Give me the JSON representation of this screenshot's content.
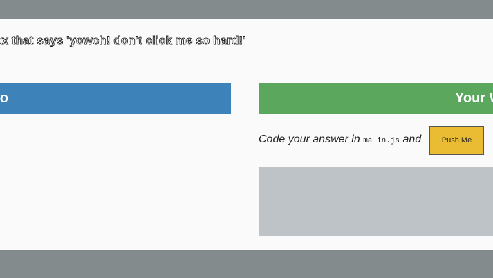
{
  "instruction": {
    "text": "ox that says 'yowch! don't click me so hard!'"
  },
  "demo": {
    "header": "mo"
  },
  "yours": {
    "header": "Your W",
    "code_prefix": "Code your answer in ",
    "code_file": "ma in.js",
    "code_suffix": " and",
    "button_label": "Push Me"
  },
  "colors": {
    "frame": "#838b8c",
    "demo_header": "#3d82b8",
    "yours_header": "#5ca75e",
    "button": "#e9bc34",
    "answer_box": "#bdc3c6"
  }
}
